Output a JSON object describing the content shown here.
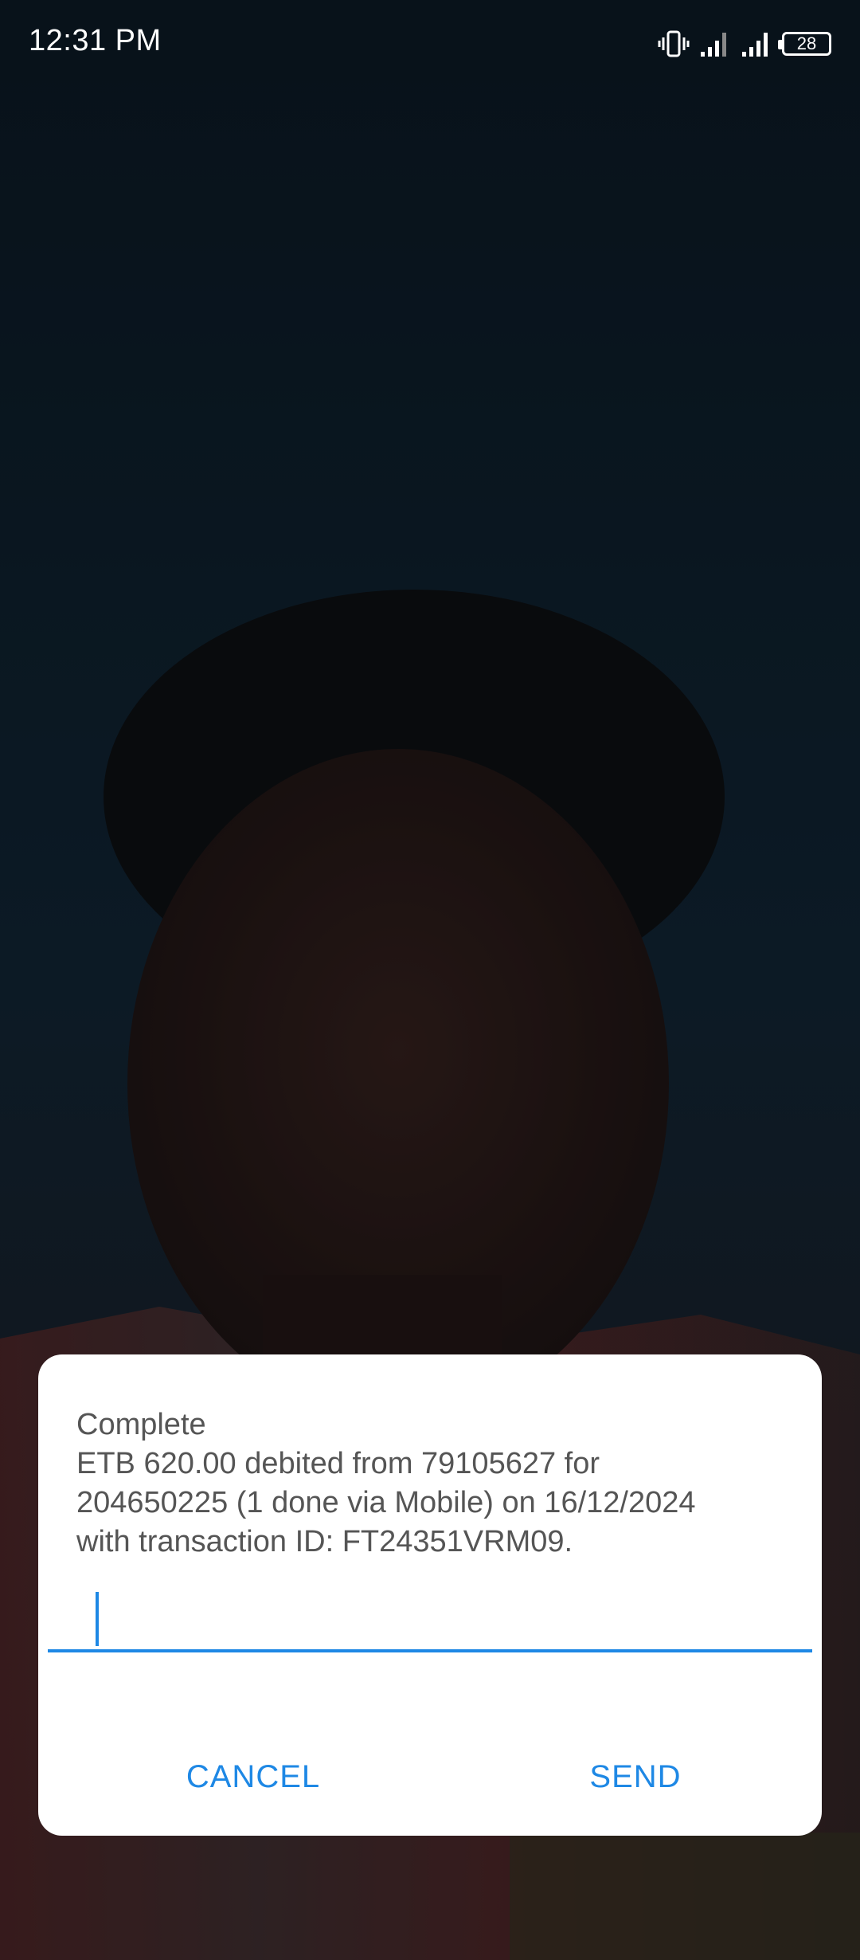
{
  "status_bar": {
    "time": "12:31 PM",
    "battery_level": "28"
  },
  "dialog": {
    "message_lines": [
      "Complete",
      "ETB 620.00 debited from 79105627 for",
      "204650225 (1 done via Mobile) on 16/12/2024",
      "with transaction ID: FT24351VRM09."
    ],
    "input_value": "",
    "cancel_label": "CANCEL",
    "send_label": "SEND"
  },
  "colors": {
    "accent": "#1e88e5",
    "dialog_bg": "#ffffff",
    "message_text": "#555555"
  }
}
